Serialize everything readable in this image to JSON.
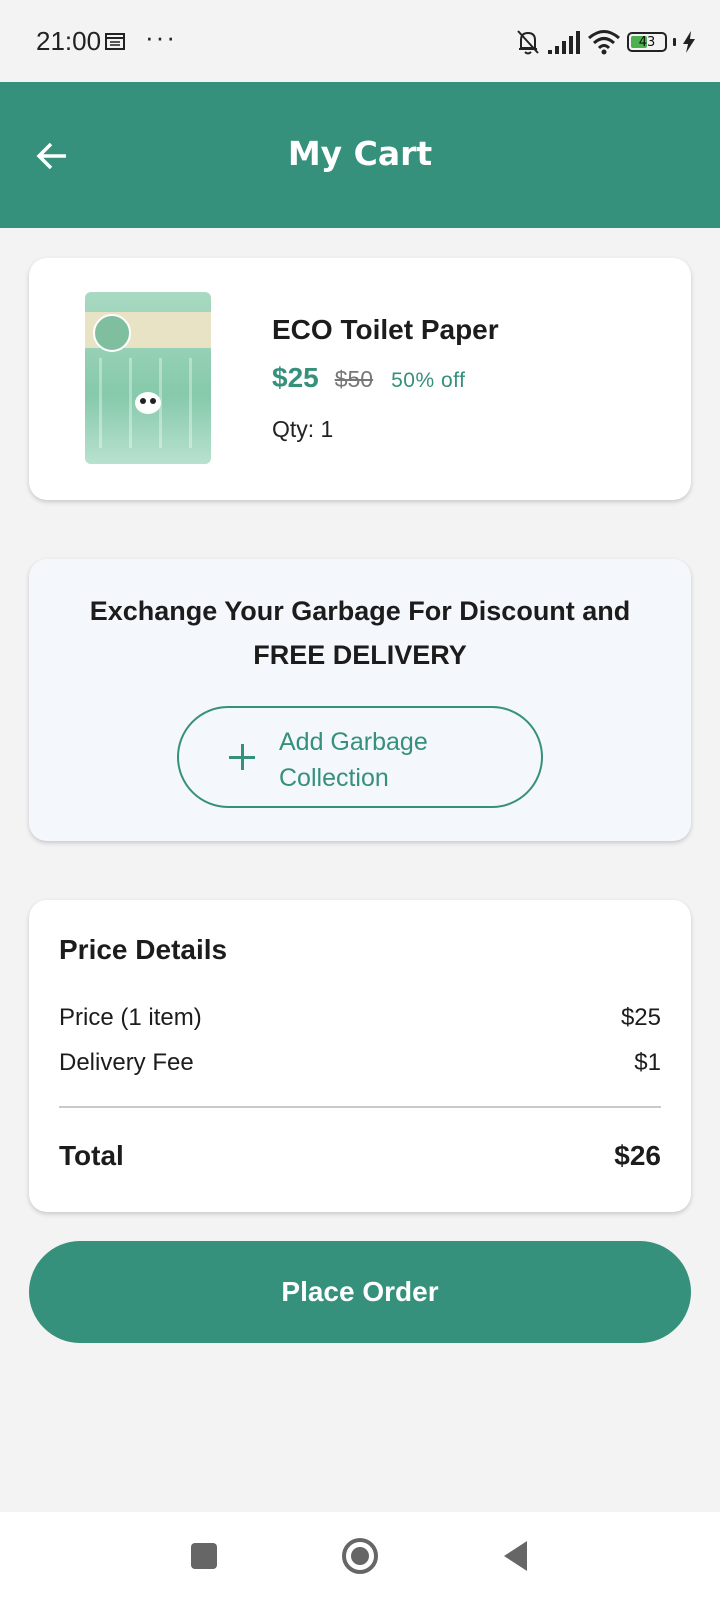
{
  "status_bar": {
    "time": "21:00",
    "dots": "···",
    "battery_level": "43"
  },
  "header": {
    "title": "My Cart"
  },
  "cart_item": {
    "name": "ECO Toilet Paper",
    "price": "$25",
    "original_price": "$50",
    "discount": "50% off",
    "quantity": "Qty: 1",
    "image": "eco-toilet-paper-package"
  },
  "garbage_offer": {
    "line1": "Exchange Your Garbage For Discount and",
    "line2": "FREE DELIVERY",
    "button_line1": "Add Garbage",
    "button_line2": "Collection"
  },
  "price_details": {
    "title": "Price Details",
    "price_label": "Price (1 item)",
    "price_value": "$25",
    "delivery_label": "Delivery Fee",
    "delivery_value": "$1",
    "total_label": "Total",
    "total_value": "$26"
  },
  "actions": {
    "place_order": "Place Order"
  },
  "colors": {
    "primary": "#35907c",
    "background": "#f3f3f3",
    "offer_card": "#f4f7fc"
  }
}
